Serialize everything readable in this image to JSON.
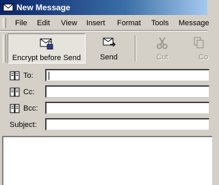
{
  "window": {
    "title": "New Message",
    "icon": "envelope-icon"
  },
  "menu": {
    "items": [
      "File",
      "Edit",
      "View",
      "Insert",
      "Format",
      "Tools",
      "Message"
    ]
  },
  "toolbar": {
    "encrypt_label": "Encrypt before Send",
    "send_label": "Send",
    "cut_label": "Cut",
    "copy_label": "Co"
  },
  "fields": {
    "to_label": "To:",
    "cc_label": "Cc:",
    "bcc_label": "Bcc:",
    "subject_label": "Subject:",
    "to_value": "",
    "cc_value": "",
    "bcc_value": "",
    "subject_value": ""
  },
  "body": {
    "text": ""
  },
  "colors": {
    "titlebar_start": "#0a246a",
    "titlebar_end": "#a6caf0",
    "chrome": "#d4d0c8"
  }
}
